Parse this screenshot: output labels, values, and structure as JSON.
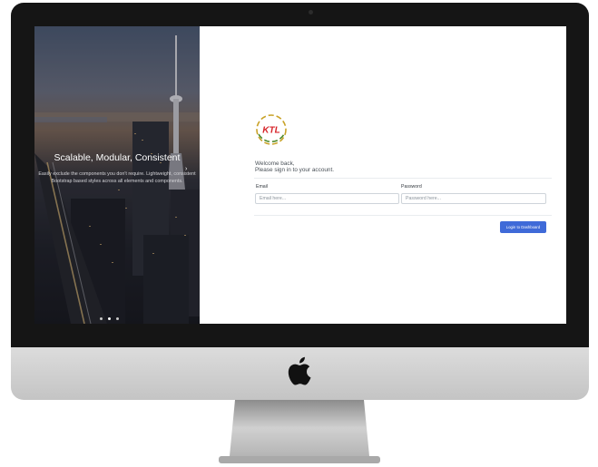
{
  "hero": {
    "title": "Scalable, Modular, Consistent",
    "text": "Easily exclude the components you don't require. Lightweight, consistent Bootstrap based styles across all elements and components.",
    "slides": 3,
    "active_slide": 2
  },
  "login": {
    "logo_text": "KTL",
    "welcome_line1": "Welcome back,",
    "welcome_line2": "Please sign in to your account.",
    "email_label": "Email",
    "email_placeholder": "Email here...",
    "password_label": "Password",
    "password_placeholder": "Password here...",
    "submit_label": "Login to Dashboard"
  },
  "colors": {
    "primary": "#3f6ad8",
    "logo_red": "#d7262b",
    "logo_gold": "#c9a227",
    "logo_green": "#4f8a2b"
  },
  "icons": [
    "apple-logo-icon",
    "chevron-right-icon"
  ]
}
